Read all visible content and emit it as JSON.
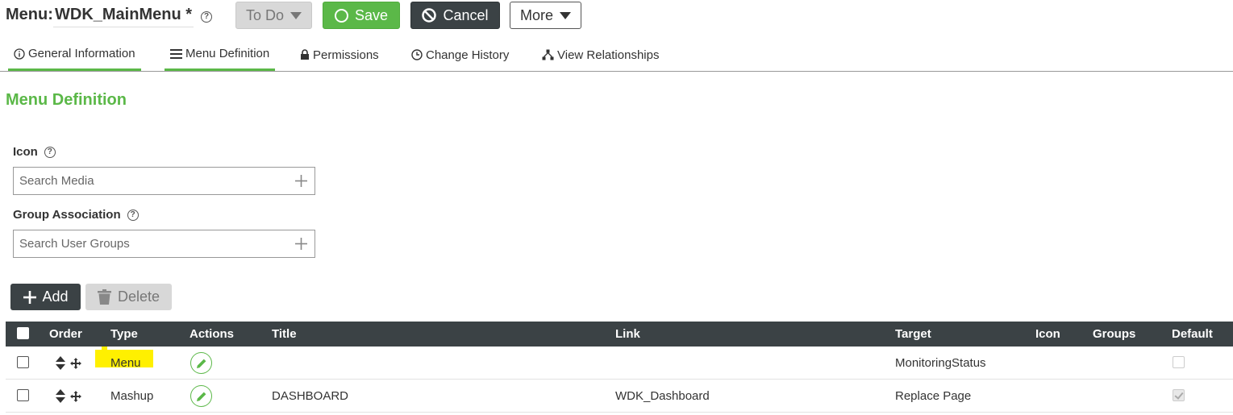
{
  "header": {
    "title_label": "Menu:",
    "title_name": "WDK_MainMenu *",
    "todo_label": "To Do",
    "save_label": "Save",
    "cancel_label": "Cancel",
    "more_label": "More"
  },
  "tabs": [
    {
      "label": "General Information",
      "icon": "info-icon",
      "active": true
    },
    {
      "label": "Menu Definition",
      "icon": "list-icon",
      "active": true
    },
    {
      "label": "Permissions",
      "icon": "lock-icon",
      "active": false
    },
    {
      "label": "Change History",
      "icon": "clock-icon",
      "active": false
    },
    {
      "label": "View Relationships",
      "icon": "relationships-icon",
      "active": false
    }
  ],
  "section": {
    "title": "Menu Definition",
    "icon_label": "Icon",
    "icon_placeholder": "Search Media",
    "group_label": "Group Association",
    "group_placeholder": "Search User Groups",
    "add_label": "Add",
    "delete_label": "Delete"
  },
  "table": {
    "columns": [
      "Order",
      "Type",
      "Actions",
      "Title",
      "Link",
      "Target",
      "Icon",
      "Groups",
      "Default"
    ],
    "rows": [
      {
        "type": "Menu",
        "title": "",
        "link": "",
        "target": "MonitoringStatus",
        "icon": "",
        "groups": "",
        "default": false,
        "highlighted": true
      },
      {
        "type": "Mashup",
        "title": "DASHBOARD",
        "link": "WDK_Dashboard",
        "target": "Replace Page",
        "icon": "",
        "groups": "",
        "default": true,
        "highlighted": false
      }
    ]
  },
  "colors": {
    "accent_green": "#5bb848",
    "dark": "#3b4245",
    "highlight": "#fff000",
    "disabled_bg": "#d8d8d8"
  }
}
